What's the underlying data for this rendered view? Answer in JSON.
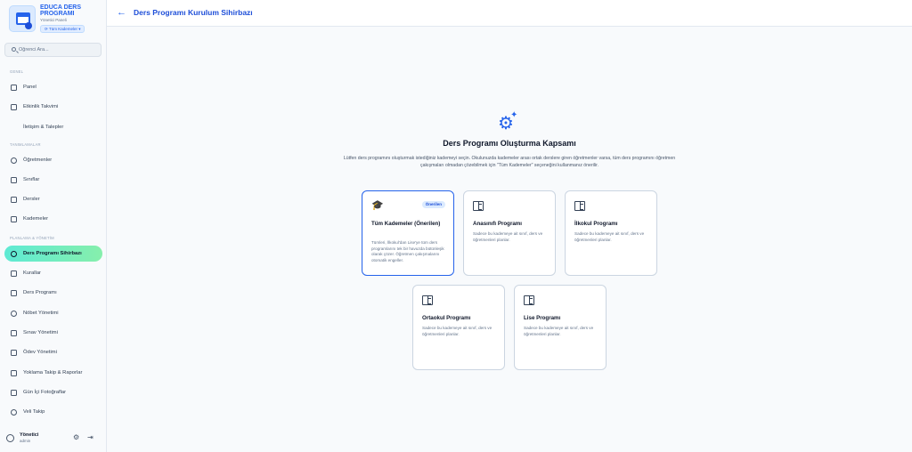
{
  "brand": {
    "title": "EDUCA DERS PROGRAMI",
    "subtitle": "Yönetici Paneli",
    "level_selector": "⟳ Tüm Kademeler ▾"
  },
  "search": {
    "placeholder": "Öğrenci Ara..."
  },
  "sidebar": {
    "sections": [
      "GENEL",
      "TANIMLAMALAR",
      "PLANLAMA & YÖNETİM"
    ],
    "items": [
      {
        "label": "Panel",
        "icon": "grid-icon"
      },
      {
        "label": "Etkinlik Takvimi",
        "icon": "calendar-icon"
      },
      {
        "label": "İletişim & Talepler",
        "icon": "message-icon"
      },
      {
        "label": "Öğretmenler",
        "icon": "user-icon"
      },
      {
        "label": "Sınıflar",
        "icon": "building-icon"
      },
      {
        "label": "Dersler",
        "icon": "book-icon"
      },
      {
        "label": "Kademeler",
        "icon": "hierarchy-icon"
      },
      {
        "label": "Ders Programı Sihirbazı",
        "icon": "gear-icon",
        "active": true
      },
      {
        "label": "Kurallar",
        "icon": "scale-icon"
      },
      {
        "label": "Ders Programı",
        "icon": "calendar-icon"
      },
      {
        "label": "Nöbet Yönetimi",
        "icon": "shield-icon"
      },
      {
        "label": "Sınav Yönetimi",
        "icon": "clipboard-icon"
      },
      {
        "label": "Ödev Yönetimi",
        "icon": "document-icon"
      },
      {
        "label": "Yoklama Takip & Raporlar",
        "icon": "checklist-icon"
      },
      {
        "label": "Gün İçi Fotoğraflar",
        "icon": "camera-icon"
      },
      {
        "label": "Veli Takip",
        "icon": "family-icon"
      }
    ]
  },
  "user": {
    "name": "Yönetici",
    "role": "admin"
  },
  "header": {
    "title": "Ders Programı Kurulum Sihirbazı"
  },
  "main": {
    "title": "Ders Programı Oluşturma Kapsamı",
    "description": "Lütfen ders programını oluşturmak istediğiniz kademeyi seçin. Okulunuzda kademeler arası ortak derslere giren öğretmenler varsa, tüm ders programını öğretmen çakışmaları olmadan çözebilmek için \"Tüm Kademeler\" seçeneğini kullanmanız önerilir.",
    "cards": [
      {
        "title": "Tüm Kademeler (Önerilen)",
        "badge": "Önerilen",
        "icon": "graduation-cap-icon",
        "description": "Tümleri, İlkokul'dan Lise'ye tüm ders programlarını tek bir havuzda bütünleşik olarak çözer. Öğretmen çakışmalarını otomatik engeller.",
        "selected": true
      },
      {
        "title": "Anasınıfı Programı",
        "icon": "book-icon",
        "description": "Sadece bu kademeye ait sınıf, ders ve öğretmenleri planlar."
      },
      {
        "title": "İlkokul Programı",
        "icon": "book-icon",
        "description": "Sadece bu kademeye ait sınıf, ders ve öğretmenleri planlar."
      },
      {
        "title": "Ortaokul Programı",
        "icon": "book-icon",
        "description": "Sadece bu kademeye ait sınıf, ders ve öğretmenleri planlar."
      },
      {
        "title": "Lise Programı",
        "icon": "book-icon",
        "description": "Sadece bu kademeye ait sınıf, ders ve öğretmenleri planlar."
      }
    ]
  },
  "colors": {
    "accent": "#2563eb",
    "active_nav": "#5eead4",
    "background": "#f8fafc"
  }
}
